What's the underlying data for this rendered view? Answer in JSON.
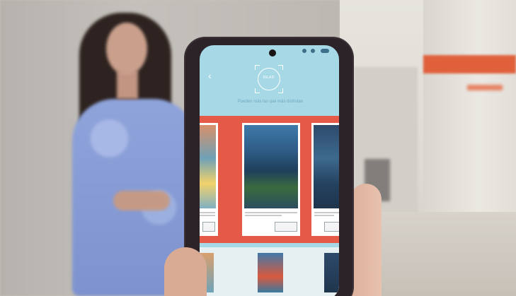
{
  "app": {
    "logo_text": "READ",
    "subtitle": "Pueden más las que más disfrutan"
  },
  "colors": {
    "screen_bg": "#a6d8e6",
    "carousel_red": "#e55a46",
    "card_white": "#ffffff"
  },
  "icons": [
    "back-arrow-icon",
    "camera-icon",
    "logo-icon"
  ]
}
